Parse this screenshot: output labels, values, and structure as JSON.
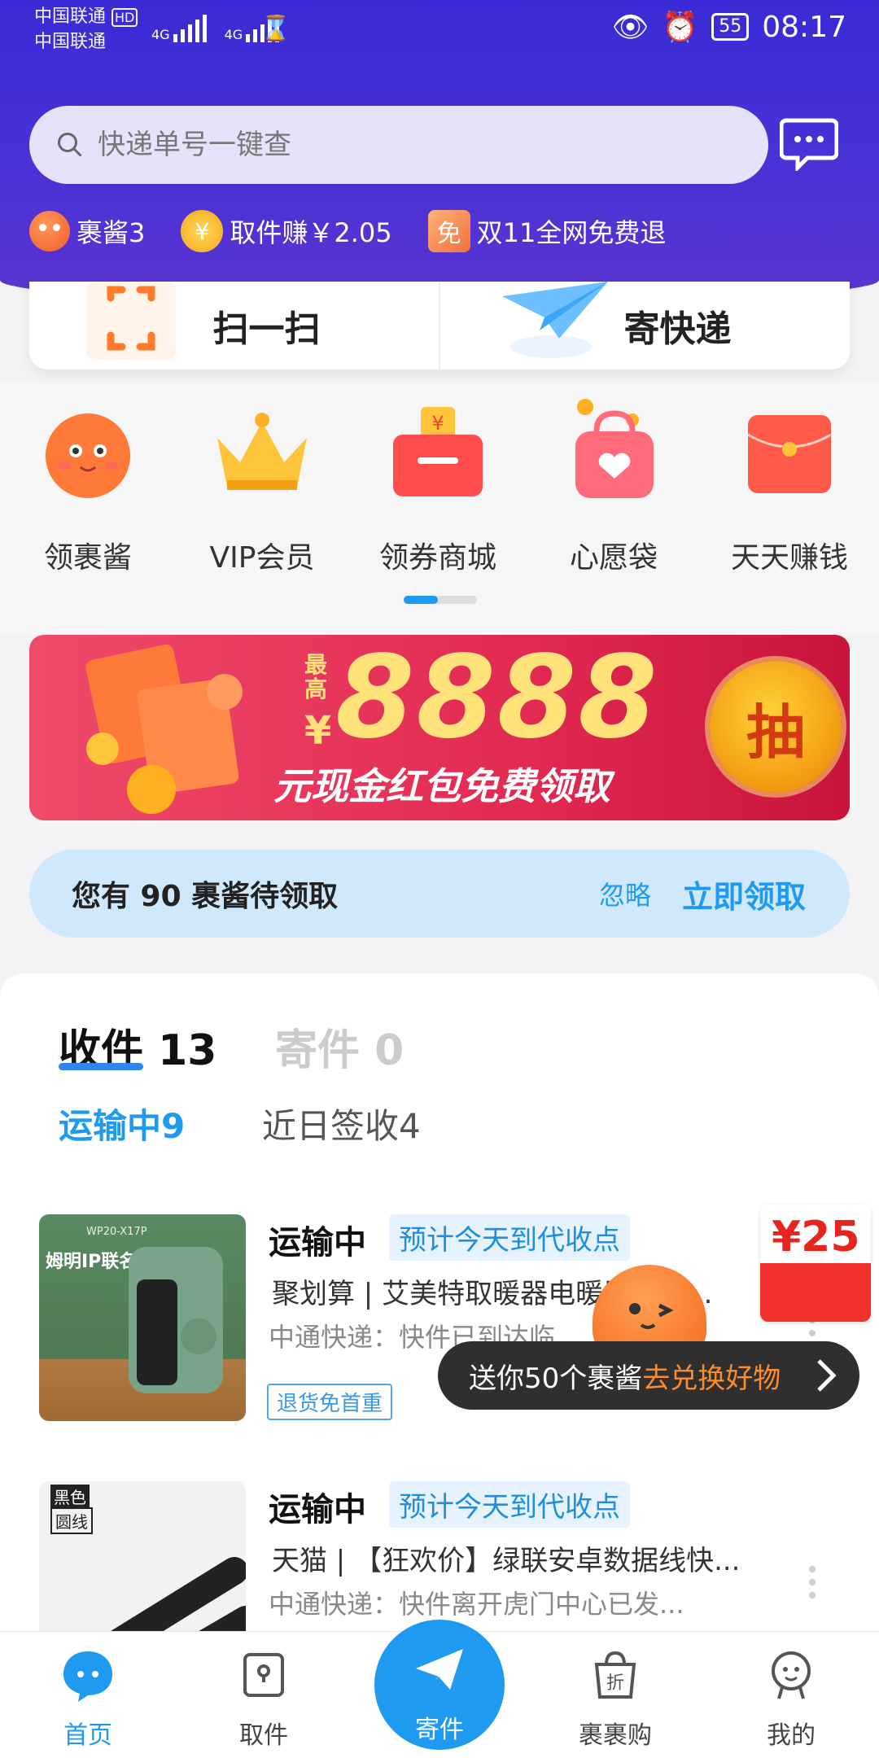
{
  "statusbar": {
    "carrier1": "中国联通",
    "carrier1_badge": "HD",
    "carrier2": "中国联通",
    "net1": "4G",
    "net2": "4G",
    "battery": "55",
    "time": "08:17"
  },
  "search": {
    "placeholder": "快递单号一键查"
  },
  "promo": {
    "mascot": "裹酱3",
    "earn": "取件赚￥2.05",
    "free_return": "双11全网免费退"
  },
  "actions": {
    "scan": "扫一扫",
    "send": "寄快递"
  },
  "categories": [
    {
      "label": "领裹酱",
      "icon": "mascot-icon"
    },
    {
      "label": "VIP会员",
      "icon": "crown-icon"
    },
    {
      "label": "领券商城",
      "icon": "coupon-box-icon"
    },
    {
      "label": "心愿袋",
      "icon": "wish-bag-icon"
    },
    {
      "label": "天天赚钱",
      "icon": "red-envelope-icon"
    }
  ],
  "banner": {
    "top_text": "最高",
    "currency": "¥",
    "amount": "8888",
    "text": "元现金红包免费领取",
    "button": "抽"
  },
  "notice": {
    "text": "您有 90 裹酱待领取",
    "ignore": "忽略",
    "claim": "立即领取"
  },
  "parcels": {
    "tab_receive": "收件 13",
    "tab_send": "寄件 0",
    "sub_transit": "运输中9",
    "sub_signed": "近日签收4",
    "items": [
      {
        "status": "运输中",
        "tag": "预计今天到代收点",
        "title": "聚划算 | 艾美特取暖器电暖器家用...",
        "info": "中通快递：快件已到达临...",
        "badge": "退货免首重",
        "thumb_text": "姆明IP联名",
        "thumb_model": "WP20-X17P"
      },
      {
        "status": "运输中",
        "tag": "预计今天到代收点",
        "title": "天猫 | 【狂欢价】绿联安卓数据线快...",
        "info": "中通快递：快件离开虎门中心已发...",
        "thumb_label1": "黑色",
        "thumb_label2": "圆线"
      }
    ]
  },
  "floating": {
    "red_packet": "¥25",
    "toast_prefix": "送你50个裹酱",
    "toast_highlight": "去兑换好物"
  },
  "nav": {
    "home": "首页",
    "pickup": "取件",
    "send": "寄件",
    "shop": "裹裹购",
    "mine": "我的"
  },
  "colors": {
    "header": "#3a2bd6",
    "accent": "#1e9bf0",
    "banner": "#e22a52",
    "toast_highlight": "#ff8a2a"
  }
}
